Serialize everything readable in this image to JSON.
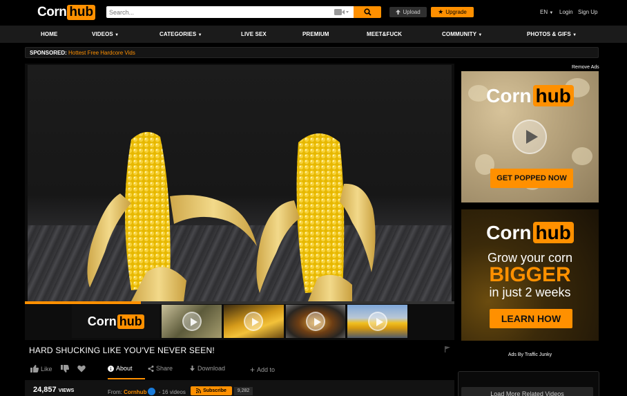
{
  "header": {
    "logo_part1": "Corn",
    "logo_part2": "hub",
    "search_placeholder": "Search...",
    "upload_label": "Upload",
    "upgrade_label": "Upgrade",
    "language": "EN",
    "login": "Login",
    "signup": "Sign Up"
  },
  "nav": {
    "items": [
      {
        "label": "HOME",
        "dropdown": false
      },
      {
        "label": "VIDEOS",
        "dropdown": true
      },
      {
        "label": "CATEGORIES",
        "dropdown": true
      },
      {
        "label": "LIVE SEX",
        "dropdown": false
      },
      {
        "label": "PREMIUM",
        "dropdown": false
      },
      {
        "label": "MEET&FUCK",
        "dropdown": false
      },
      {
        "label": "COMMUNITY",
        "dropdown": true
      },
      {
        "label": "PHOTOS & GIFS",
        "dropdown": true
      }
    ]
  },
  "sponsored": {
    "label": "SPONSORED:",
    "link": "Hottest Free Hardcore Vids"
  },
  "player": {
    "progress_fraction": 0.27,
    "thumb_logo_part1": "Corn",
    "thumb_logo_part2": "hub"
  },
  "video": {
    "title": "HARD SHUCKING LIKE YOU'VE NEVER SEEN!",
    "like_label": "Like",
    "about_label": "About",
    "share_label": "Share",
    "download_label": "Download",
    "add_to_label": "Add to",
    "views": "24,857",
    "views_label": "VIEWS",
    "from_label": "From:",
    "channel": "Cornhub",
    "channel_videos": "- 16 videos",
    "subscribe_label": "Subscribe",
    "subscriber_count": "9,282"
  },
  "sidebar": {
    "remove_ads": "Remove Ads",
    "ad1": {
      "logo_part1": "Corn",
      "logo_part2": "hub",
      "cta": "GET POPPED NOW"
    },
    "ad2": {
      "logo_part1": "Corn",
      "logo_part2": "hub",
      "line1": "Grow your corn",
      "line2": "BIGGER",
      "line3": "in just 2 weeks",
      "cta": "LEARN HOW"
    },
    "ads_by": "Ads By Traffic Junky",
    "load_more": "Load More Related Videos"
  },
  "colors": {
    "accent": "#ff9000",
    "background": "#000000",
    "nav_background": "#1b1b1b",
    "verified": "#1a7cdb"
  }
}
